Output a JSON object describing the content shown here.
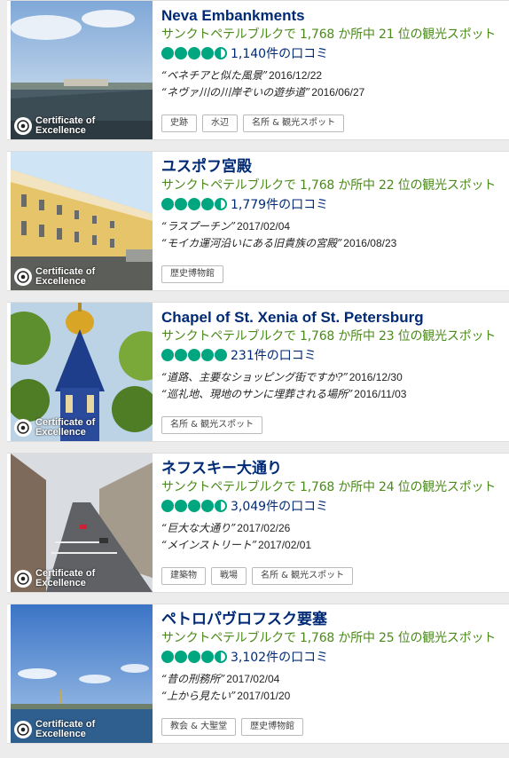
{
  "coe": {
    "line1": "Certificate of",
    "line2": "Excellence"
  },
  "items": [
    {
      "title": "Neva Embankments",
      "rank": "サンクトペテルブルクで 1,768 か所中 21 位の観光スポット",
      "rating": 4.5,
      "reviews": "1,140件の口コミ",
      "quotes": [
        {
          "text": "“ベネチアと似た風景”",
          "date": "2016/12/22"
        },
        {
          "text": "“ネヴァ川の川岸ぞいの遊歩道”",
          "date": "2016/06/27"
        }
      ],
      "tags": [
        "史跡",
        "水辺",
        "名所 & 観光スポット"
      ]
    },
    {
      "title": "ユスポフ宮殿",
      "rank": "サンクトペテルブルクで 1,768 か所中 22 位の観光スポット",
      "rating": 4.5,
      "reviews": "1,779件の口コミ",
      "quotes": [
        {
          "text": "“ラスプーチン”",
          "date": "2017/02/04"
        },
        {
          "text": "“モイカ運河沿いにある旧貴族の宮殿”",
          "date": "2016/08/23"
        }
      ],
      "tags": [
        "歴史博物館"
      ]
    },
    {
      "title": "Chapel of St. Xenia of St. Petersburg",
      "rank": "サンクトペテルブルクで 1,768 か所中 23 位の観光スポット",
      "rating": 5,
      "reviews": "231件の口コミ",
      "quotes": [
        {
          "text": "“道路、主要なショッピング街ですか?”",
          "date": "2016/12/30"
        },
        {
          "text": "“巡礼地、現地のサンに埋葬される場所”",
          "date": "2016/11/03"
        }
      ],
      "tags": [
        "名所 & 観光スポット"
      ]
    },
    {
      "title": "ネフスキー大通り",
      "rank": "サンクトペテルブルクで 1,768 か所中 24 位の観光スポット",
      "rating": 4.5,
      "reviews": "3,049件の口コミ",
      "quotes": [
        {
          "text": "“巨大な大通り”",
          "date": "2017/02/26"
        },
        {
          "text": "“メインストリート”",
          "date": "2017/02/01"
        }
      ],
      "tags": [
        "建築物",
        "戦場",
        "名所 & 観光スポット"
      ]
    },
    {
      "title": "ペトロパヴロフスク要塞",
      "rank": "サンクトペテルブルクで 1,768 か所中 25 位の観光スポット",
      "rating": 4.5,
      "reviews": "3,102件の口コミ",
      "quotes": [
        {
          "text": "“昔の刑務所”",
          "date": "2017/02/04"
        },
        {
          "text": "“上から見たい”",
          "date": "2017/01/20"
        }
      ],
      "tags": [
        "教会 & 大聖堂",
        "歴史博物館"
      ]
    }
  ]
}
